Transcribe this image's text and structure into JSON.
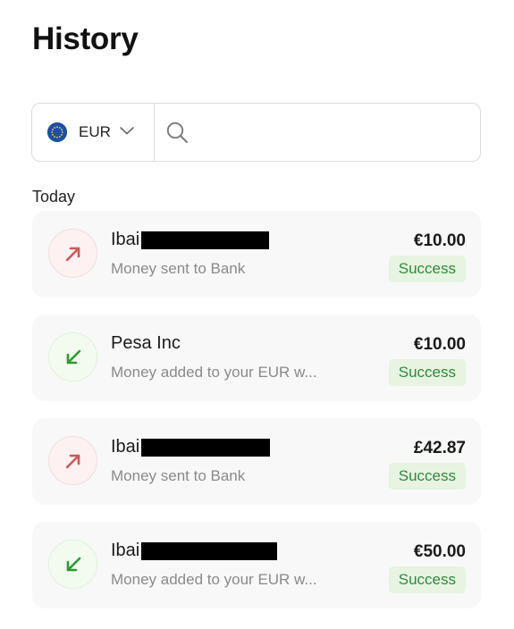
{
  "header": {
    "title": "History"
  },
  "filter": {
    "currency_code": "EUR",
    "currency_flag_icon": "eu-flag-icon",
    "search_placeholder": "",
    "search_value": ""
  },
  "section": {
    "label": "Today"
  },
  "colors": {
    "sent_arrow": "#c75a5a",
    "received_arrow": "#2f9a2f",
    "status_bg": "#e6f4e1",
    "status_text": "#2f8a3a"
  },
  "transactions": [
    {
      "direction": "sent",
      "icon": "arrow-up-right-icon",
      "name": "Ibai",
      "name_redacted": true,
      "description": "Money sent to Bank",
      "amount": "€10.00",
      "status": "Success"
    },
    {
      "direction": "received",
      "icon": "arrow-down-left-icon",
      "name": "Pesa Inc",
      "name_redacted": false,
      "description": "Money added to your EUR w...",
      "amount": "€10.00",
      "status": "Success"
    },
    {
      "direction": "sent",
      "icon": "arrow-up-right-icon",
      "name": "Ibai",
      "name_redacted": true,
      "description": "Money sent to Bank",
      "amount": "£42.87",
      "status": "Success"
    },
    {
      "direction": "received",
      "icon": "arrow-down-left-icon",
      "name": "Ibai",
      "name_redacted": true,
      "description": "Money added to your EUR w...",
      "amount": "€50.00",
      "status": "Success"
    }
  ]
}
